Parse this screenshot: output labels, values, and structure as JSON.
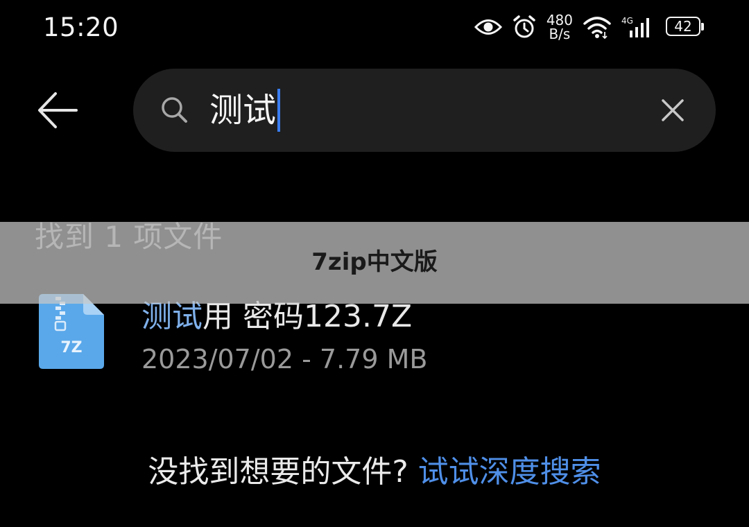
{
  "status_bar": {
    "time": "15:20",
    "net_speed_value": "480",
    "net_speed_unit": "B/s",
    "network_type": "4G",
    "battery_percent": "42",
    "icons": [
      "eye-icon",
      "alarm-icon",
      "wifi-icon",
      "signal-icon",
      "battery-icon"
    ]
  },
  "search": {
    "query": "测试",
    "icons": [
      "back-arrow-icon",
      "search-icon",
      "clear-icon"
    ]
  },
  "results": {
    "count_text": "找到 1 项文件",
    "files": [
      {
        "icon_label": "7Z",
        "name_highlight": "测试",
        "name_rest": "用 密码123.7Z",
        "meta": "2023/07/02 - 7.79 MB"
      }
    ]
  },
  "banner": {
    "text": "7zip中文版"
  },
  "footer": {
    "hint_text": "没找到想要的文件? ",
    "link_text": "试试深度搜索"
  },
  "colors": {
    "background": "#000000",
    "search_box": "#1f1f1f",
    "highlight": "#7fb0ea",
    "link": "#4f8fe8",
    "caret": "#3a7df0",
    "file_icon": "#5aa8ea"
  }
}
